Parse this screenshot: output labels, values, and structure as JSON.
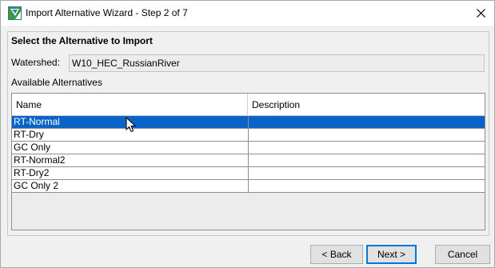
{
  "window": {
    "title": "Import Alternative Wizard - Step 2 of 7"
  },
  "section": {
    "title": "Select the Alternative to Import"
  },
  "watershed": {
    "label": "Watershed:",
    "value": "W10_HEC_RussianRiver"
  },
  "alternatives": {
    "label": "Available Alternatives",
    "columns": [
      "Name",
      "Description"
    ],
    "rows": [
      {
        "name": "RT-Normal",
        "description": "",
        "selected": true
      },
      {
        "name": "RT-Dry",
        "description": "",
        "selected": false
      },
      {
        "name": "GC Only",
        "description": "",
        "selected": false
      },
      {
        "name": "RT-Normal2",
        "description": "",
        "selected": false
      },
      {
        "name": "RT-Dry2",
        "description": "",
        "selected": false
      },
      {
        "name": "GC Only 2",
        "description": "",
        "selected": false
      }
    ]
  },
  "buttons": {
    "back": "< Back",
    "next": "Next >",
    "cancel": "Cancel"
  },
  "colors": {
    "selection": "#0a64c8",
    "default_button_border": "#0078d7"
  },
  "icons": {
    "app": "wizard-app-icon",
    "close": "close-icon",
    "cursor": "mouse-pointer-icon"
  }
}
